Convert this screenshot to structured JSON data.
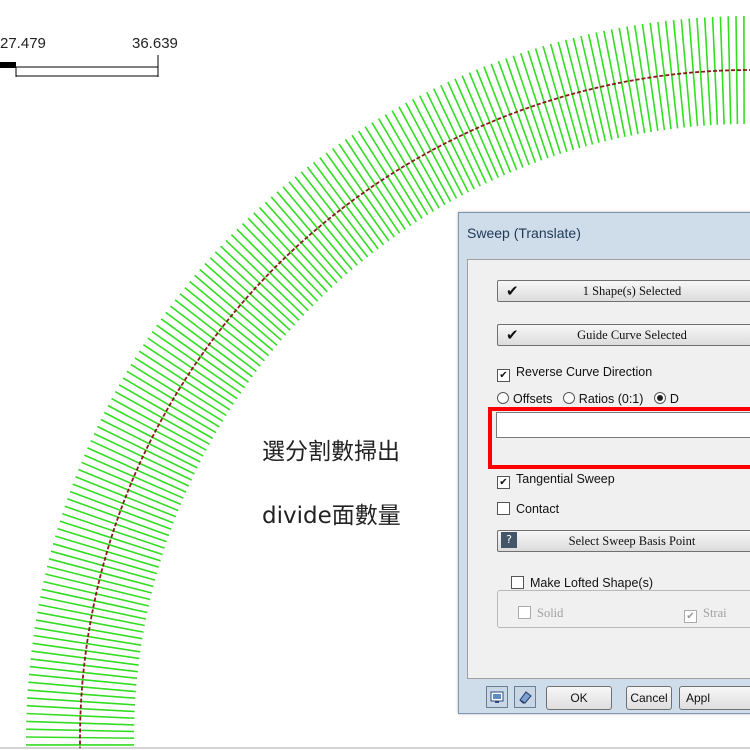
{
  "scale_bar": {
    "label_left": "27.479",
    "label_right": "36.639"
  },
  "annotations": {
    "line1": "選分割數掃出",
    "line2": "divide面數量"
  },
  "dialog": {
    "title": "Sweep (Translate)",
    "shape_button": {
      "check": "✔",
      "label": "1 Shape(s) Selected"
    },
    "guide_button": {
      "check": "✔",
      "label": "Guide Curve Selected"
    },
    "reverse_curve": {
      "label": "Reverse Curve Direction",
      "checked": true
    },
    "mode_options": [
      {
        "label": "Offsets",
        "selected": false
      },
      {
        "label": "Ratios (0:1)",
        "selected": false
      },
      {
        "label": "D",
        "selected": true
      }
    ],
    "divide_input": {
      "value": ""
    },
    "tangential_sweep": {
      "label": "Tangential Sweep",
      "checked": true
    },
    "contact": {
      "label": "Contact",
      "checked": false
    },
    "help_glyph": "?",
    "basis_point_button": "Select Sweep Basis Point",
    "make_lofted": {
      "label": "Make Lofted Shape(s)",
      "checked": false
    },
    "solid": {
      "label": "Solid",
      "checked": false
    },
    "straight": {
      "label": "Strai",
      "checked": true
    },
    "ok": "OK",
    "cancel": "Cancel",
    "apply": "Appl"
  },
  "colors": {
    "ticks": "#33dd22",
    "curve": "#8b1a1a",
    "highlight": "#ff0000",
    "dialog_frame": "#cfdcea"
  },
  "icons": [
    "preview-icon",
    "eraser-icon",
    "help-icon",
    "check-icon"
  ]
}
